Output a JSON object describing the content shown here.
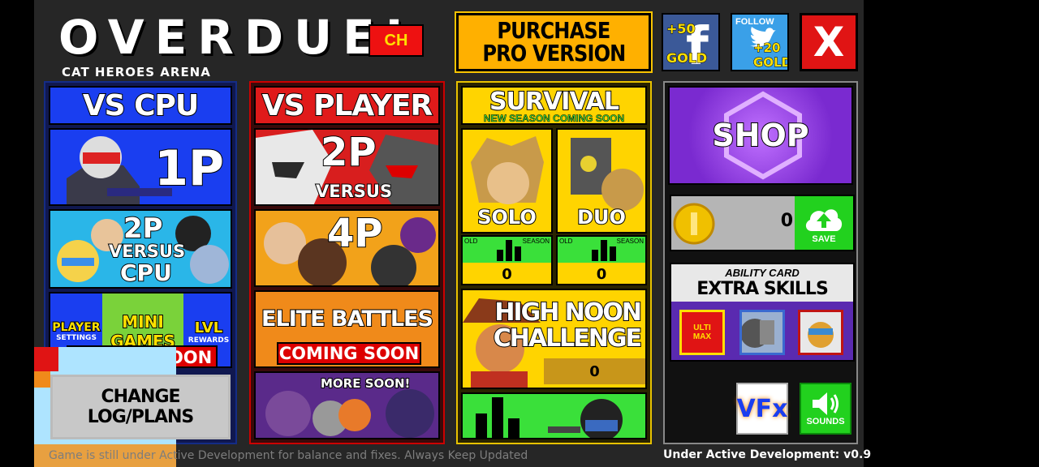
{
  "header": {
    "title": "OVERDUEL",
    "subtitle": "CAT HEROES ARENA",
    "ch_label": "CH",
    "purchase_line1": "PURCHASE",
    "purchase_line2": "PRO VERSION",
    "facebook_reward": "+50",
    "facebook_gold": "GOLD",
    "facebook_glyph": "f",
    "twitter_follow": "FOLLOW",
    "twitter_reward": "+20",
    "twitter_gold": "GOLD",
    "close_label": "X"
  },
  "vs_cpu": {
    "title": "VS CPU",
    "one_p": "1P",
    "two_p": "2P",
    "versus": "VERSUS",
    "cpu": "CPU",
    "player_settings_top": "PLAYER",
    "player_settings_bottom": "SETTINGS",
    "mini_games_top": "MINI",
    "mini_games_bottom": "GAMES",
    "lvl_rewards_top": "LVL",
    "lvl_rewards_bottom": "REWARDS",
    "coming_soon": "COMING SOON"
  },
  "vs_player": {
    "title": "VS PLAYER",
    "two_p": "2P",
    "versus": "VERSUS",
    "four_p": "4P",
    "elite_battles": "ELITE BATTLES",
    "coming_soon": "COMING SOON",
    "more_soon": "MORE SOON!"
  },
  "survival": {
    "title": "SURVIVAL",
    "subtitle": "NEW SEASON COMING SOON",
    "solo": "SOLO",
    "duo": "DUO",
    "old_label": "OLD",
    "season_label": "SEASON",
    "solo_score": "0",
    "duo_score": "0",
    "high_noon_line1": "HIGH NOON",
    "high_noon_line2": "CHALLENGE",
    "high_noon_score": "0"
  },
  "sidebar": {
    "shop": "SHOP",
    "gold_amount": "0",
    "save_label": "SAVE",
    "ability_card": "ABILITY CARD",
    "extra_skills": "EXTRA SKILLS",
    "ulti_line1": "ULTI",
    "ulti_line2": "MAX",
    "vfx_label": "VFx",
    "sounds_label": "SOUNDS"
  },
  "changelog_label": "CHANGE LOG/PLANS",
  "footer": {
    "notice": "Game is still under Active Development for balance and fixes. Always Keep Updated",
    "version": "Under Active Development: v0.9"
  },
  "colors": {
    "background": "#262626",
    "accent_yellow": "#ffb000",
    "accent_red": "#e01414",
    "vs_cpu_blue": "#1a3ef0",
    "survival_yellow": "#ffd400",
    "save_green": "#22d11e"
  }
}
